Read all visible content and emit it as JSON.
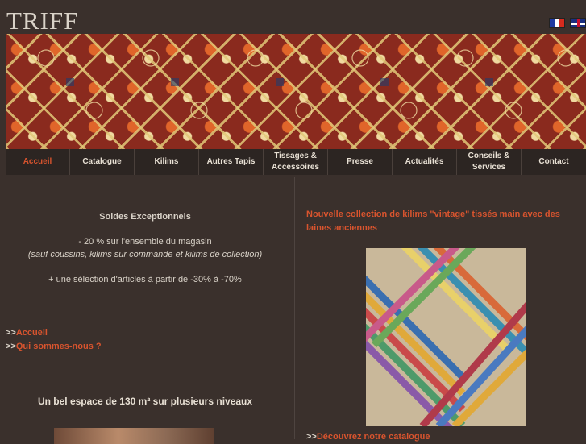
{
  "header": {
    "logo": "TRIFF"
  },
  "flags": [
    {
      "name": "flag-fr-icon"
    },
    {
      "name": "flag-en-icon"
    }
  ],
  "nav": {
    "items": [
      {
        "label": "Accueil"
      },
      {
        "label": "Catalogue"
      },
      {
        "label": "Kilims"
      },
      {
        "label": "Autres Tapis"
      },
      {
        "label": "Tissages &\nAccessoires"
      },
      {
        "label": "Presse"
      },
      {
        "label": "Actualités"
      },
      {
        "label": "Conseils &\nServices"
      },
      {
        "label": "Contact"
      }
    ],
    "active_index": 0
  },
  "left": {
    "soldes_title": "Soldes Exceptionnels",
    "soldes_line1": "- 20 % sur l'ensemble du magasin",
    "soldes_line2": "(sauf coussins, kilims sur commande et kilims de collection)",
    "soldes_line3": "+ une sélection d'articles à partir de -30% à -70%",
    "links": [
      {
        "prefix": ">>",
        "label": "Accueil"
      },
      {
        "prefix": ">>",
        "label": "Qui sommes-nous ?"
      }
    ],
    "espace_title": "Un bel espace de 130 m² sur plusieurs niveaux"
  },
  "right": {
    "news_title": "Nouvelle collection de kilims \"vintage\" tissés main avec des laines anciennes",
    "catalogue_prefix": ">>",
    "catalogue_label": "Découvrez notre catalogue"
  },
  "colors": {
    "background": "#3a302c",
    "nav_background": "#2c2522",
    "accent": "#d9542e",
    "text": "#d9d2c8"
  }
}
